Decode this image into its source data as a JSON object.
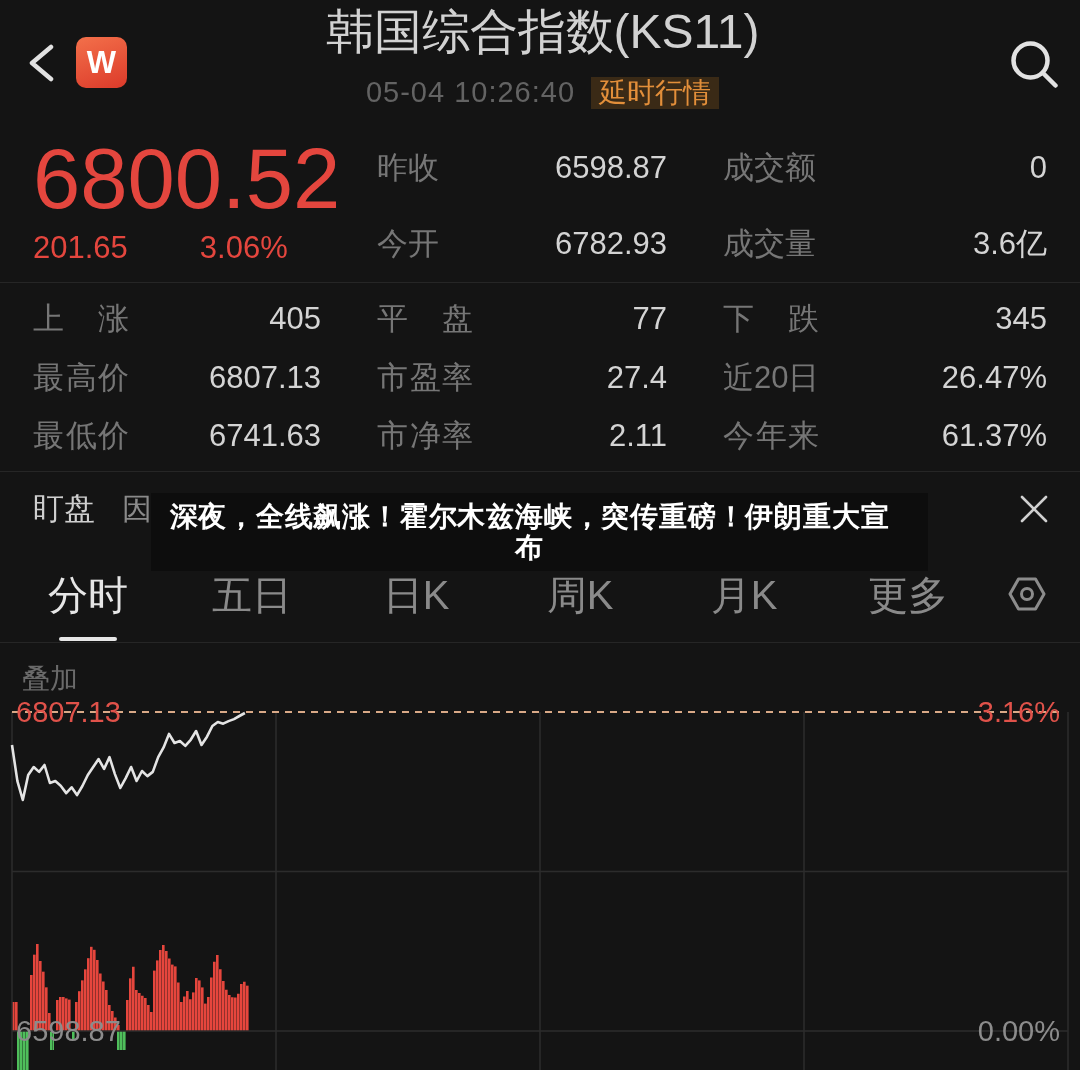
{
  "header": {
    "logo_text": "W",
    "title": "韩国综合指数(KS11)",
    "timestamp": "05-04 10:26:40",
    "badge": "延时行情"
  },
  "quote": {
    "price": "6800.52",
    "change": "201.65",
    "change_percent": "3.06%",
    "stats": [
      {
        "label": "昨收",
        "value": "6598.87"
      },
      {
        "label": "成交额",
        "value": "0"
      },
      {
        "label": "今开",
        "value": "6782.93"
      },
      {
        "label": "成交量",
        "value": "3.6亿"
      }
    ]
  },
  "market_stats": [
    {
      "label": "上 涨",
      "value": "405"
    },
    {
      "label": "平 盘",
      "value": "77"
    },
    {
      "label": "下 跌",
      "value": "345"
    },
    {
      "label": "最高价",
      "value": "6807.13"
    },
    {
      "label": "市盈率",
      "value": "27.4"
    },
    {
      "label": "近20日",
      "value": "26.47%"
    },
    {
      "label": "最低价",
      "value": "6741.63"
    },
    {
      "label": "市净率",
      "value": "2.11"
    },
    {
      "label": "今年来",
      "value": "61.37%"
    }
  ],
  "notice": {
    "title": "盯盘",
    "text": "因"
  },
  "tabs": [
    {
      "label": "分时",
      "selected": true
    },
    {
      "label": "五日",
      "selected": false
    },
    {
      "label": "日K",
      "selected": false
    },
    {
      "label": "周K",
      "selected": false
    },
    {
      "label": "月K",
      "selected": false
    },
    {
      "label": "更多",
      "selected": false
    }
  ],
  "chart": {
    "overlay_label": "叠加",
    "right_labels": [
      {
        "label": "3.16%",
        "color": "#e0524a"
      },
      {
        "label": "0.00%",
        "color": "#8c8c8c"
      }
    ],
    "chart_data": {
      "type": "line",
      "ylim": [
        6598.87,
        6807.13
      ],
      "yticks": [
        {
          "value": 6807.13,
          "label": "6807.13"
        },
        {
          "value": 6598.87,
          "label": "6598.87"
        }
      ],
      "categories": [
        null,
        null,
        null,
        null,
        null,
        null,
        null,
        null,
        null,
        null,
        null,
        null,
        null,
        null,
        null,
        null,
        null,
        null,
        null,
        null,
        null,
        null,
        null,
        null,
        null,
        null,
        null,
        null,
        null,
        null,
        null,
        null,
        null,
        null,
        null,
        null,
        null,
        null,
        null,
        null,
        null,
        null,
        null,
        null,
        null,
        null,
        null,
        null,
        null,
        null,
        null,
        null,
        null,
        null,
        null,
        null,
        null,
        null,
        null,
        null,
        null,
        null,
        null,
        null,
        null,
        null,
        null,
        null,
        null,
        null,
        null,
        null,
        null,
        null,
        null,
        null,
        null,
        null,
        null,
        null,
        null,
        null,
        null,
        null,
        null,
        null,
        null,
        null,
        null,
        null,
        null,
        null,
        null,
        null,
        null,
        null,
        null,
        null,
        null,
        null,
        null,
        null,
        null,
        null,
        null,
        null,
        null,
        null,
        null,
        null,
        null,
        null,
        null,
        null,
        null,
        null,
        null,
        null,
        null,
        null,
        null,
        null,
        null,
        null,
        null,
        null,
        null,
        null,
        null,
        null,
        null,
        null,
        null,
        null,
        null,
        null,
        null,
        null,
        null,
        null,
        null,
        null,
        null,
        null,
        null,
        null,
        null,
        null,
        null,
        null,
        null,
        null,
        null,
        null,
        null,
        null,
        null,
        null,
        null,
        null,
        null,
        null,
        null,
        null,
        null,
        null,
        null,
        null,
        null,
        null,
        null,
        null,
        null,
        null,
        null,
        null,
        null,
        null,
        null,
        null,
        null,
        null,
        null,
        null,
        null,
        null,
        null,
        null,
        null,
        null,
        null,
        null,
        null,
        null,
        null,
        null
      ],
      "values": [
        6785.6,
        6762,
        6749.7,
        6766,
        6771.2,
        6768,
        6772.5,
        6760.8,
        6762,
        6759,
        6754.2,
        6758,
        6752.9,
        6758.8,
        6766,
        6771.2,
        6776.4,
        6770,
        6777.7,
        6766.6,
        6757.5,
        6764,
        6771.2,
        6762.1,
        6768.6,
        6765.3,
        6768,
        6777.7,
        6784,
        6792.8,
        6786.9,
        6788.2,
        6785,
        6789,
        6794.7,
        6785.6,
        6791,
        6798,
        6800.6,
        6799.5,
        6801.2,
        6802.5,
        6804.5,
        6806.5,
        null,
        null,
        null,
        null,
        null,
        null,
        null,
        null,
        null,
        null,
        null,
        null,
        null,
        null,
        null,
        null,
        null,
        null,
        null,
        null,
        null,
        null,
        null,
        null,
        null,
        null,
        null,
        null,
        null,
        null,
        null,
        null,
        null,
        null,
        null,
        null,
        null,
        null,
        null,
        null,
        null,
        null,
        null,
        null,
        null,
        null,
        null,
        null,
        null,
        null,
        null,
        null,
        null,
        null,
        null,
        null,
        null,
        null,
        null,
        null,
        null,
        null,
        null,
        null,
        null,
        null,
        null,
        null,
        null,
        null,
        null,
        null,
        null,
        null,
        null,
        null,
        null,
        null,
        null,
        null,
        null,
        null,
        null,
        null,
        null,
        null,
        null,
        null,
        null,
        null,
        null,
        null,
        null,
        null,
        null,
        null,
        null,
        null,
        null,
        null,
        null,
        null,
        null,
        null,
        null,
        null,
        null,
        null,
        null,
        null,
        null,
        null,
        null,
        null,
        null,
        null,
        null,
        null,
        null,
        null,
        null,
        null,
        null,
        null,
        null,
        null,
        null,
        null,
        null,
        null,
        null,
        null,
        null,
        null,
        null,
        null,
        null,
        null,
        null,
        null,
        null,
        null,
        null,
        null,
        null,
        null,
        null,
        null,
        null,
        null,
        null,
        null
      ]
    }
  },
  "headline_banner": {
    "text": "深夜，全线飙涨！霍尔木兹海峡，突传重磅！伊朗重大宣布"
  }
}
